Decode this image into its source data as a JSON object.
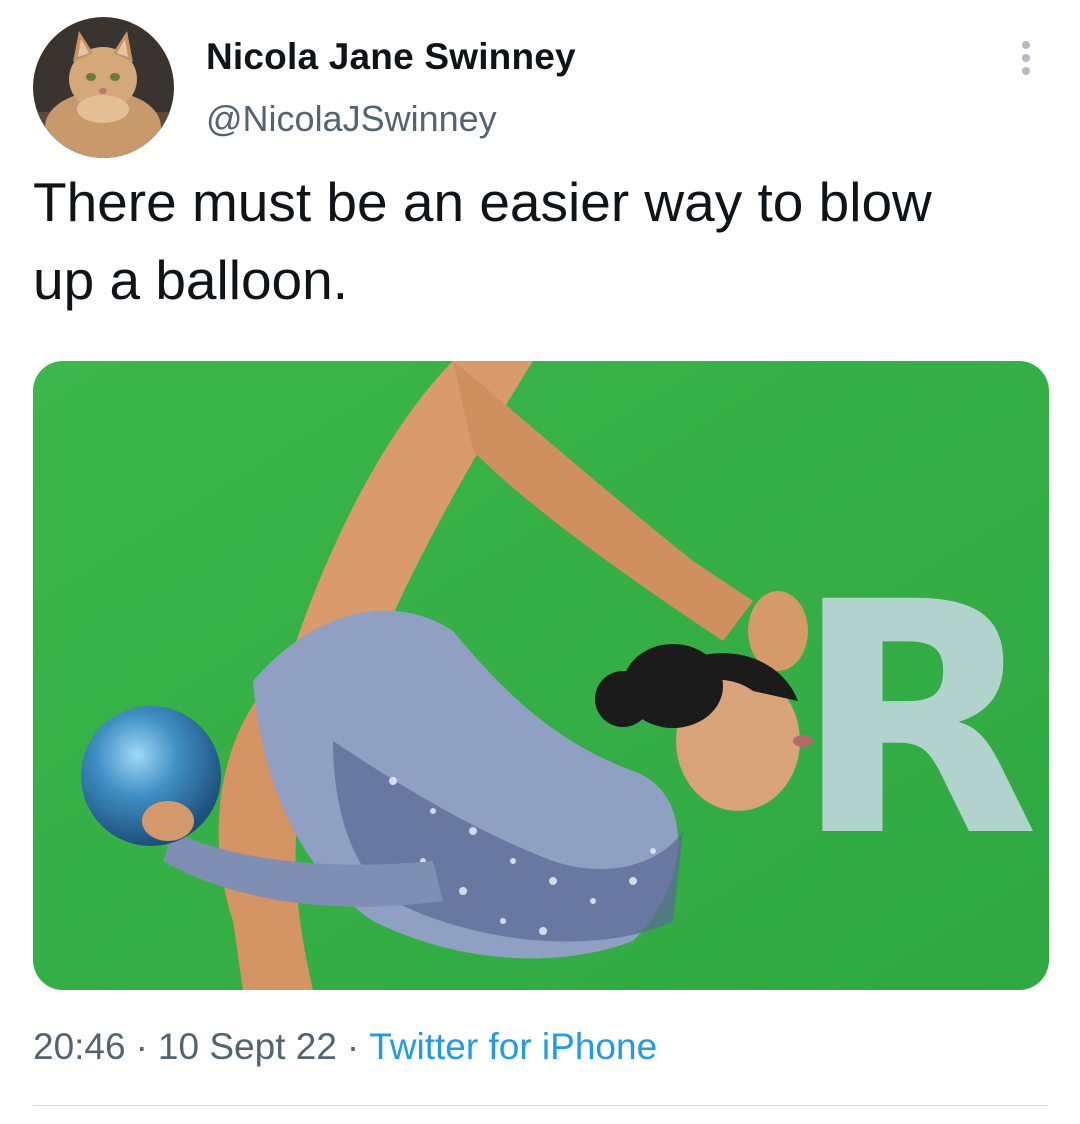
{
  "author": {
    "name": "Nicola Jane Swinney",
    "handle": "@NicolaJSwinney",
    "avatar_icon": "cat-avatar"
  },
  "tweet": {
    "text": "There must be an easier way to blow\nup a balloon.",
    "media_watermark": "Ri"
  },
  "meta": {
    "time": "20:46",
    "date": "10 Sept 22",
    "separator": "·",
    "source": "Twitter for iPhone"
  },
  "colors": {
    "text_primary": "#0f1419",
    "text_secondary": "#536471",
    "link": "#1d9bf0",
    "media_background": "#3dbb4c"
  },
  "icons": {
    "more": "more-vertical-icon"
  }
}
